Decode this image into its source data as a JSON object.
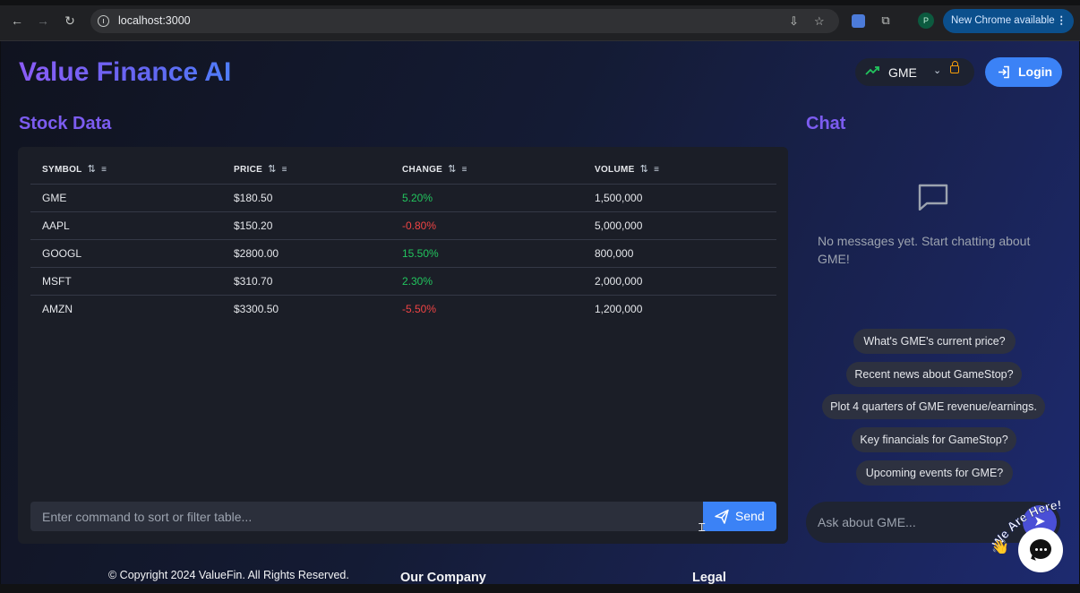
{
  "browser": {
    "url": "localhost:3000",
    "update_label": "New Chrome available",
    "update_menu": "⋮",
    "profile_initial": "P"
  },
  "header": {
    "brand": "Value Finance AI",
    "ticker": "GME",
    "login_label": "Login"
  },
  "stock": {
    "title": "Stock Data",
    "columns": [
      "SYMBOL",
      "PRICE",
      "CHANGE",
      "VOLUME"
    ],
    "rows": [
      {
        "symbol": "GME",
        "price": "$180.50",
        "change": "5.20%",
        "volume": "1,500,000",
        "direction": "up"
      },
      {
        "symbol": "AAPL",
        "price": "$150.20",
        "change": "-0.80%",
        "volume": "5,000,000",
        "direction": "down"
      },
      {
        "symbol": "GOOGL",
        "price": "$2800.00",
        "change": "15.50%",
        "volume": "800,000",
        "direction": "up"
      },
      {
        "symbol": "MSFT",
        "price": "$310.70",
        "change": "2.30%",
        "volume": "2,000,000",
        "direction": "up"
      },
      {
        "symbol": "AMZN",
        "price": "$3300.50",
        "change": "-5.50%",
        "volume": "1,200,000",
        "direction": "down"
      }
    ],
    "command_placeholder": "Enter command to sort or filter table...",
    "send_label": "Send"
  },
  "chat": {
    "title": "Chat",
    "empty_text": "No messages yet. Start chatting about GME!",
    "suggestions": [
      "What's GME's current price?",
      "Recent news about GameStop?",
      "Plot 4 quarters of GME revenue/earnings.",
      "Key financials for GameStop?",
      "Upcoming events for GME?"
    ],
    "input_placeholder": "Ask about GME..."
  },
  "widget": {
    "badge_text": "We Are Here!"
  },
  "footer": {
    "copyright": "© Copyright 2024 ValueFin. All Rights Reserved.",
    "company_heading": "Our Company",
    "legal_heading": "Legal"
  },
  "colors": {
    "accent": "#3b82f6",
    "brand_gradient_start": "#8b5cf6",
    "positive": "#22c55e",
    "negative": "#ef4444",
    "panel": "#1b1e27"
  },
  "icons": {
    "ticker": "trending-up-icon",
    "lock": "lock-icon",
    "login": "login-icon",
    "send": "send-icon",
    "chat_empty": "message-square-icon",
    "sort": "sort-icon",
    "filter": "filter-icon"
  }
}
